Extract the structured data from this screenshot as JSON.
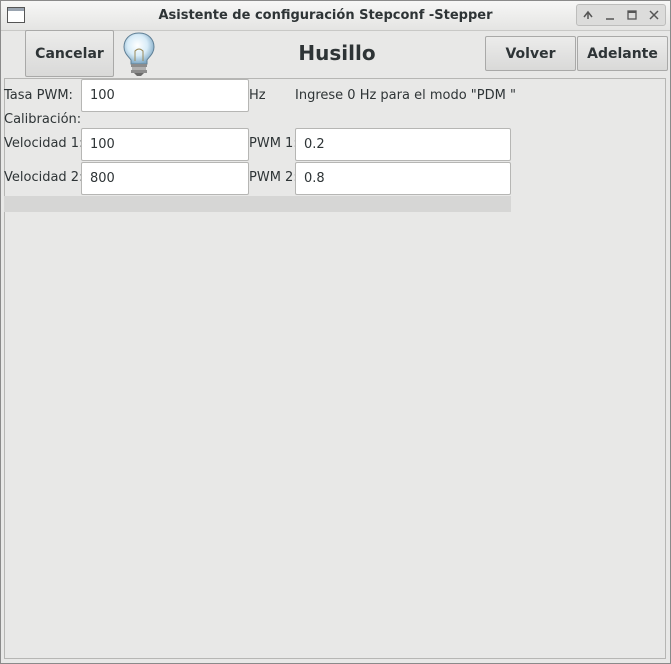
{
  "window": {
    "title": "Asistente de configuración Stepconf -Stepper"
  },
  "toolbar": {
    "cancel_label": "Cancelar",
    "page_title": "Husillo",
    "back_label": "Volver",
    "forward_label": "Adelante"
  },
  "form": {
    "pwm_rate_label": "Tasa PWM:",
    "pwm_rate_value": "100",
    "pwm_rate_unit": "Hz",
    "pdm_hint": "Ingrese 0 Hz para el modo \"PDM \"",
    "calibration_label": "Calibración:",
    "speed1_label": "Velocidad 1:",
    "speed1_value": "100",
    "pwm1_label": "PWM 1:",
    "pwm1_value": "0.2",
    "speed2_label": "Velocidad 2:",
    "speed2_value": "800",
    "pwm2_label": "PWM 2:",
    "pwm2_value": "0.8"
  },
  "icons": {
    "window_icon": "window-icon",
    "hint_icon": "lightbulb-icon",
    "wm_shade": "shade-icon",
    "wm_minimize": "minimize-icon",
    "wm_maximize": "maximize-icon",
    "wm_close": "close-icon"
  }
}
